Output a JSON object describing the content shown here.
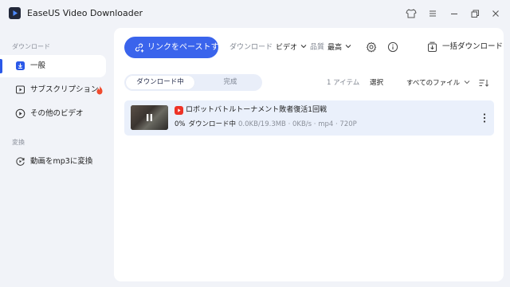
{
  "app": {
    "title": "EaseUS Video Downloader"
  },
  "titlebar_icons": [
    "tshirt-icon",
    "menu-icon",
    "minimize-icon",
    "restore-icon",
    "close-icon"
  ],
  "sidebar": {
    "section_download": "ダウンロード",
    "items": [
      {
        "label": "一般",
        "icon": "download-icon",
        "active": true
      },
      {
        "label": "サブスクリプション",
        "icon": "subscription-icon",
        "badge_icon": "flame-icon"
      },
      {
        "label": "その他のビデオ",
        "icon": "play-circle-icon"
      }
    ],
    "section_convert": "変換",
    "convert_items": [
      {
        "label": "動画をmp3に変換",
        "icon": "convert-icon"
      }
    ]
  },
  "toolbar": {
    "paste_label": "リンクをペーストする",
    "download_key": "ダウンロード",
    "download_value": "ビデオ",
    "quality_key": "品質",
    "quality_value": "最高",
    "bulk_label": "一括ダウンロード"
  },
  "tabs": {
    "downloading": "ダウンロード中",
    "completed": "完成"
  },
  "list_controls": {
    "count": "1 アイテム",
    "select": "選択",
    "filter": "すべてのファイル"
  },
  "downloads": [
    {
      "title": "ロボットバトルトーナメント敗者復活1回戦",
      "percent": "0%",
      "status": "ダウンロード中",
      "meta": "0.0KB/19.3MB · 0KB/s · mp4 · 720P",
      "progress": 0
    }
  ],
  "colors": {
    "accent": "#3a64ec",
    "background": "#f1f3f8",
    "row_highlight": "#eaf0fb",
    "flame": "#f04b2e",
    "youtube_red": "#ee3226"
  }
}
